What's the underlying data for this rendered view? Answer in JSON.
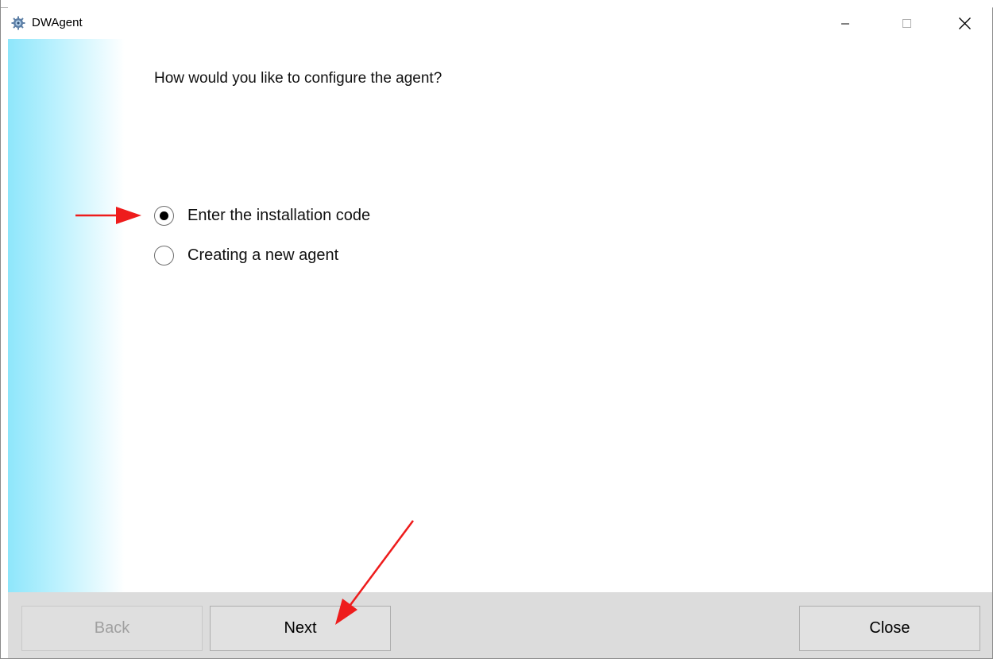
{
  "window": {
    "title": "DWAgent",
    "app_icon": "gear-icon",
    "controls": [
      "minimize-icon",
      "maximize-icon",
      "close-icon"
    ]
  },
  "main": {
    "question": "How would you like to configure the agent?",
    "options": [
      {
        "label": "Enter the installation code",
        "selected": true
      },
      {
        "label": "Creating a new agent",
        "selected": false
      }
    ]
  },
  "footer": {
    "back_label": "Back",
    "back_enabled": false,
    "next_label": "Next",
    "close_label": "Close"
  },
  "annotations": {
    "color": "#ee1c1c",
    "arrows": [
      "points to Enter the installation code",
      "points to Next"
    ]
  }
}
